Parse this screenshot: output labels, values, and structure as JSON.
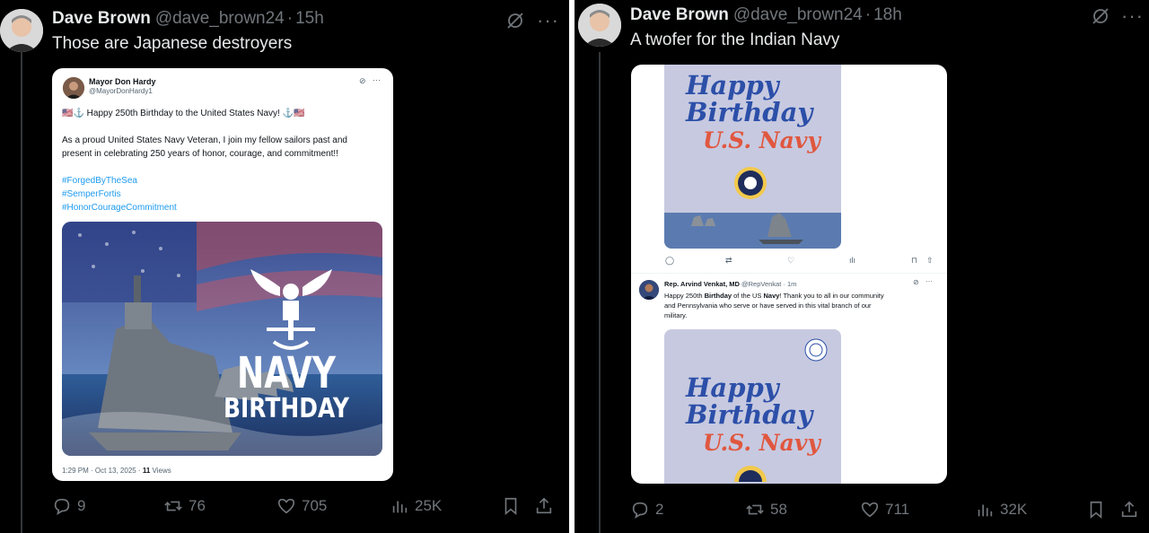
{
  "left": {
    "author": {
      "name": "Dave Brown",
      "handle": "@dave_brown24",
      "time": "15h"
    },
    "text": "Those are Japanese destroyers",
    "quoted": {
      "name": "Mayor Don Hardy",
      "handle": "@MayorDonHardy1",
      "line1": "🇺🇸⚓ Happy 250th Birthday to the United States Navy! ⚓🇺🇸",
      "line2": "As a proud United States Navy Veteran, I join my fellow sailors past and",
      "line3": "present in celebrating 250 years of honor, courage, and commitment!!",
      "tags": [
        "#ForgedByTheSea",
        "#SemperFortis",
        "#HonorCourageCommitment"
      ],
      "image_text_top": "NAVY",
      "image_text_bottom": "BIRTHDAY",
      "meta_time": "1:29 PM · Oct 13, 2025 · ",
      "meta_views_count": "11",
      "meta_views_label": " Views"
    },
    "actions": {
      "replies": "9",
      "reposts": "76",
      "likes": "705",
      "views": "25K"
    }
  },
  "right": {
    "author": {
      "name": "Dave Brown",
      "handle": "@dave_brown24",
      "time": "18h"
    },
    "text": "A twofer for the Indian Navy",
    "card_lines": [
      "Happy",
      "Birthday",
      "U.S. Navy"
    ],
    "inner_actions": {
      "replies": "",
      "reposts": "",
      "likes": "",
      "views": ""
    },
    "reply": {
      "name": "Rep. Arvind Venkat, MD",
      "handle": "@RepVenkat",
      "time": "1m",
      "text_a": "Happy 250th ",
      "text_b": "Birthday",
      "text_c": " of the US ",
      "text_d": "Navy",
      "text_e": "! Thank you to all in our community",
      "line2": "and Pennsylvania who serve or have served in this vital branch of our",
      "line3": "military."
    },
    "actions": {
      "replies": "2",
      "reposts": "58",
      "likes": "711",
      "views": "32K"
    }
  },
  "colors": {
    "background": "#000000",
    "muted": "#71767b",
    "link": "#1d9bf0",
    "card": "#c7c9e0",
    "navy_blue": "#2c4fa8",
    "navy_red": "#e0573f"
  },
  "icons": [
    "reply-icon",
    "repost-icon",
    "like-icon",
    "views-icon",
    "bookmark-icon",
    "share-icon",
    "grok-icon",
    "more-icon"
  ]
}
